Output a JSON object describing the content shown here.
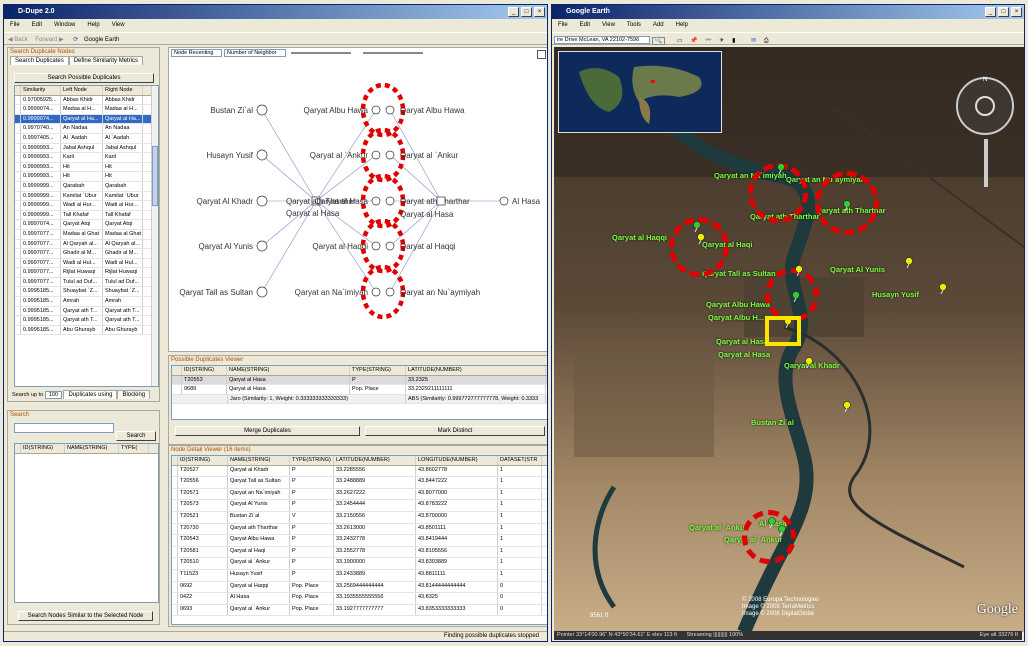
{
  "ddupe": {
    "title": "D-Dupe 2.0",
    "menu": [
      "File",
      "Edit",
      "Window",
      "Help",
      "View"
    ],
    "toolbar": {
      "back": "Back",
      "forward": "Forward",
      "ge": "Google Earth"
    },
    "left": {
      "section": "Search Duplicate Nodes",
      "tabs": [
        "Search Duplicates",
        "Define Similarity Metrics"
      ],
      "search_btn": "Search Possible Duplicates",
      "columns": [
        "Similarity",
        "Left Node",
        "Right Node"
      ],
      "rows": [
        [
          "0.97005925...",
          "Abbas Khidr",
          "Abbas Khidr"
        ],
        [
          "0.9999074...",
          "Madaa al H...",
          "Madaa al H..."
        ],
        [
          "0.9999074...",
          "Qaryat al Ha...",
          "Qaryat al Ha..."
        ],
        [
          "0.9970740...",
          "An Nadaa",
          "An Nadaa"
        ],
        [
          "0.9997405...",
          "Al `Aadah",
          "Al `Aadah"
        ],
        [
          "0.9999993...",
          "Jabal Ashqul",
          "Jabal Ashqul"
        ],
        [
          "0.9999993...",
          "Karil",
          "Karil"
        ],
        [
          "0.9999993...",
          "Hit",
          "Hit"
        ],
        [
          "0.9999993...",
          "Hit",
          "Hit"
        ],
        [
          "0.9999999...",
          "Qarabah",
          "Qarabah"
        ],
        [
          "0.9999999...",
          "Kamilat `Ubur",
          "Kamilat `Ubur"
        ],
        [
          "0.9999999...",
          "Wadi al Hur...",
          "Wadi al Hur..."
        ],
        [
          "0.9999999...",
          "Tall Khafaf",
          "Tall Khafaf"
        ],
        [
          "0.9997074...",
          "Qaryat Atqi",
          "Qaryat Atqi"
        ],
        [
          "0.9997077...",
          "Madaa al Ghat",
          "Madaa al Ghat"
        ],
        [
          "0.9997077...",
          "Al Qaryah al...",
          "Al Qaryah al..."
        ],
        [
          "0.9997077...",
          "Ghadir al M...",
          "Ghadir al M..."
        ],
        [
          "0.9997077...",
          "Wadi al Hul...",
          "Wadi al Hul..."
        ],
        [
          "0.9997077...",
          "Rijlat Huwaqi",
          "Rijlat Huwaqi"
        ],
        [
          "0.9997077...",
          "Tulul ad Duf...",
          "Tulul ad Duf..."
        ],
        [
          "0.9995185...",
          "Shuaybat `Z...",
          "Shuaybat `Z..."
        ],
        [
          "0.9995185...",
          "Amrah",
          "Amrah"
        ],
        [
          "0.9995185...",
          "Qaryat ath T...",
          "Qaryat ath T..."
        ],
        [
          "0.9995185...",
          "Qaryat ath T...",
          "Qaryat ath T..."
        ],
        [
          "0.9995185...",
          "Abu Ghurayb",
          "Abu Ghurayb"
        ]
      ],
      "bottom": {
        "label": "Search up to",
        "value": "100",
        "tab1": "Duplicates using",
        "tab2": "Blocking"
      },
      "search_section": "Search",
      "search_btn2": "Search",
      "search_cols": [
        "ID(STRING)",
        "NAME(STRING)",
        "TYPE("
      ],
      "similar_btn": "Search Nodes Similar to the Selected Node"
    },
    "graph": {
      "dropdown1": "Node Recenting",
      "dropdown2": "Number of Neighbor",
      "left_nodes": [
        "Bustan Zi`al",
        "Husayn Yusif",
        "Qaryat Al Khadr",
        "Qaryat Al Yunis",
        "Qaryat Tall as Sultan"
      ],
      "center": [
        "Qaryat ath Tharthar",
        "Qaryat al Hasa"
      ],
      "pairs_left": [
        "Qaryat Albu Hawa",
        "Qaryat al `Ankur",
        "Qaryat al Hasa",
        "Qaryat al Haqqi",
        "Qaryat an Na`imiyah"
      ],
      "pairs_right": [
        "Qaryat Albu Hawa",
        "Qaryat al `Ankur",
        "Qaryat ath Tharthar",
        "Qaryat al Hasa",
        "Qaryat al Haqqi",
        "Qaryat an Nu`aymiyah"
      ],
      "far_right": "Al Hasa"
    },
    "dup_viewer": {
      "title": "Possible Duplicates Viewer",
      "columns": [
        "ID(STRING)",
        "NAME(STRING)",
        "TYPE(STRING)",
        "LATITUDE(NUMBER)"
      ],
      "rows": [
        [
          "T20553",
          "Qaryat al Hasa",
          "P",
          "33.2325"
        ],
        [
          "0689",
          "Qaryat al Hasa",
          "Pop. Place",
          "33.2329211111111"
        ]
      ],
      "summary_left": "Jaro (Similarity: 1, Weight: 0.333333333333333)",
      "summary_right": "ABS (Similarity: 0.999772777777778, Weight: 0.3333",
      "merge_btn": "Merge Duplicates",
      "distinct_btn": "Mark Distinct"
    },
    "node_viewer": {
      "title": "Node Detail Viewer (16 items)",
      "columns": [
        "ID(STRING)",
        "NAME(STRING)",
        "TYPE(STRING)",
        "LATITUDE(NUMBER)",
        "LONGITUDE(NUMBER)",
        "DATASET(STR"
      ],
      "rows": [
        [
          "T20527",
          "Qaryat al Khadr",
          "P",
          "33.2285556",
          "43.8602778",
          "1"
        ],
        [
          "T20556",
          "Qaryat Tall as Sultan",
          "P",
          "33.2488889",
          "43.8447222",
          "1"
        ],
        [
          "T20571",
          "Qaryat an Na`imiyah",
          "P",
          "33.2627222",
          "43.8077000",
          "1"
        ],
        [
          "T20573",
          "Qaryat Al Yunis",
          "P",
          "33.2454444",
          "43.8783222",
          "1"
        ],
        [
          "T20521",
          "Bustan Zi`al",
          "V",
          "33.2150556",
          "43.8700000",
          "1"
        ],
        [
          "T20730",
          "Qaryat ath Tharthar",
          "P",
          "33.2613000",
          "43.8501111",
          "1"
        ],
        [
          "T20543",
          "Qaryat Albu Hawa",
          "P",
          "33.2432778",
          "43.8419444",
          "1"
        ],
        [
          "T20581",
          "Qaryat al Haqi",
          "P",
          "33.2552778",
          "43.8105556",
          "1"
        ],
        [
          "T20510",
          "Qaryat al `Ankur",
          "P",
          "33.1900000",
          "43.8303889",
          "1"
        ],
        [
          "T11523",
          "Husayn Yusif",
          "P",
          "33.2433889",
          "43.8811111",
          "1"
        ],
        [
          "0692",
          "Qaryat al Haqqi",
          "Pop. Place",
          "33.2569444444444",
          "43.8144444444444",
          "0"
        ],
        [
          "0422",
          "Al Hasa",
          "Pop. Place",
          "33.1935555555556",
          "43.8325",
          "0"
        ],
        [
          "0693",
          "Qaryat al `Ankur",
          "Pop. Place",
          "33.1927777777777",
          "43.8353333333333",
          "0"
        ]
      ]
    },
    "status": "Finding possible duplicates stopped"
  },
  "ge": {
    "title": "Google Earth",
    "menu": [
      "File",
      "Edit",
      "View",
      "Tools",
      "Add",
      "Help"
    ],
    "location": "ire Drive McLean, VA 22102-7596",
    "labels": [
      "Qaryat an Nu`aymiyah",
      "Qaryat an Na`imiyah",
      "Qaryat ath Tharthar",
      "Qaryat ath Tharthar",
      "Qaryat al Haqqi",
      "Qaryat al Haqi",
      "Qaryat Tall as Sultan",
      "Qaryat Al Yunis",
      "Husayn Yusif",
      "Qaryat Albu Hawa",
      "Qaryat Albu H...",
      "Qaryat al Hasa",
      "Qaryat al Hasa",
      "Qaryat al Khadr",
      "Bustan Zi`al",
      "Qaryat al `Ankur",
      "Al Hasa",
      "Qaryat al `Ankur"
    ],
    "copyright": [
      "© 2008 Europa Technologies",
      "Image © 2008 TerraMetrics",
      "Image © 2008 DigitalGlobe"
    ],
    "scale": "9561 ft",
    "logo": "Google",
    "statusbar": {
      "pointer": "Pointer  33°14'00.96\" N  43°50'34.61\" E  elev  113 ft",
      "streaming": "Streaming |||||||||| 100%",
      "eye": "Eye alt  33276 ft"
    }
  }
}
